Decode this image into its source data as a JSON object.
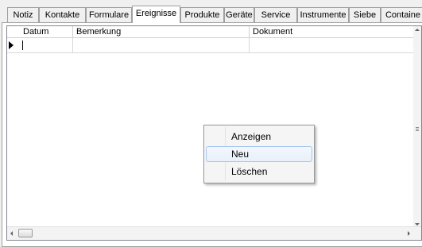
{
  "tabs": [
    {
      "label": "Notiz",
      "active": false
    },
    {
      "label": "Kontakte",
      "active": false
    },
    {
      "label": "Formulare",
      "active": false
    },
    {
      "label": "Ereignisse",
      "active": true
    },
    {
      "label": "Produkte",
      "active": false
    },
    {
      "label": "Geräte",
      "active": false
    },
    {
      "label": "Service",
      "active": false
    },
    {
      "label": "Instrumente",
      "active": false
    },
    {
      "label": "Siebe",
      "active": false
    },
    {
      "label": "Containe",
      "active": false
    }
  ],
  "grid": {
    "columns": [
      "Datum",
      "Bemerkung",
      "Dokument"
    ],
    "rows": [
      {
        "datum": "",
        "bemerkung": "",
        "dokument": ""
      }
    ]
  },
  "context_menu": {
    "items": [
      "Anzeigen",
      "Neu",
      "Löschen"
    ],
    "highlighted": "Neu"
  },
  "icons": {
    "row_indicator": "current-row-arrow-icon",
    "scroll_left": "chevron-left-icon",
    "scroll_right": "chevron-right-icon",
    "scroll_up": "chevron-up-icon",
    "scroll_down": "chevron-down-icon",
    "grip": "scroll-grip-icon"
  },
  "colors": {
    "window_bg": "#f0f0f0",
    "border": "#a0a0a0",
    "menu_highlight_border": "#a8c7ee"
  }
}
